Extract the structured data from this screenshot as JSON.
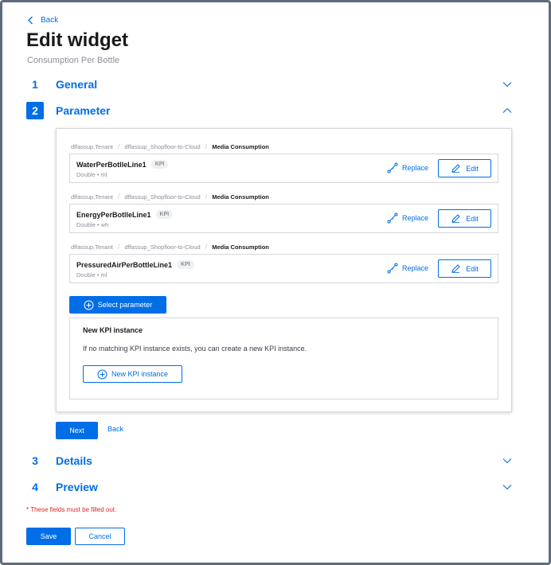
{
  "header": {
    "back_label": "Back",
    "title": "Edit widget",
    "subtitle": "Consumption Per Bottle"
  },
  "steps": [
    {
      "number": "1",
      "label": "General",
      "expanded": false
    },
    {
      "number": "2",
      "label": "Parameter",
      "expanded": true
    },
    {
      "number": "3",
      "label": "Details",
      "expanded": false
    },
    {
      "number": "4",
      "label": "Preview",
      "expanded": false
    }
  ],
  "parameters": [
    {
      "breadcrumb": [
        "dffassup.Tenant",
        "dffassup_Shopfloor-to-Cloud",
        "Media Consumption"
      ],
      "name": "WaterPerBotlleLine1",
      "badge": "KPI",
      "type": "Double • ml",
      "replace_label": "Replace",
      "edit_label": "Edit"
    },
    {
      "breadcrumb": [
        "dffassup.Tenant",
        "dffassup_Shopfloor-to-Cloud",
        "Media Consumption"
      ],
      "name": "EnergyPerBotlleLine1",
      "badge": "KPI",
      "type": "Double • wh",
      "replace_label": "Replace",
      "edit_label": "Edit"
    },
    {
      "breadcrumb": [
        "dffassup.Tenant",
        "dffassup_Shopfloor-to-Cloud",
        "Media Consumption"
      ],
      "name": "PressuredAirPerBottleLine1",
      "badge": "KPI",
      "type": "Double • ml",
      "replace_label": "Replace",
      "edit_label": "Edit"
    }
  ],
  "select_parameter_label": "Select parameter",
  "new_kpi": {
    "title": "New KPI instance",
    "description": "If no matching KPI instance exists, you can create a new KPI instance.",
    "button_label": "New KPI instance"
  },
  "step_nav": {
    "next_label": "Next",
    "back_label": "Back"
  },
  "required_note": "* These fields must be filled out.",
  "footer": {
    "save_label": "Save",
    "cancel_label": "Cancel"
  },
  "colors": {
    "accent": "#006ee6",
    "error": "#d72828",
    "frame": "#5e6b7e"
  }
}
